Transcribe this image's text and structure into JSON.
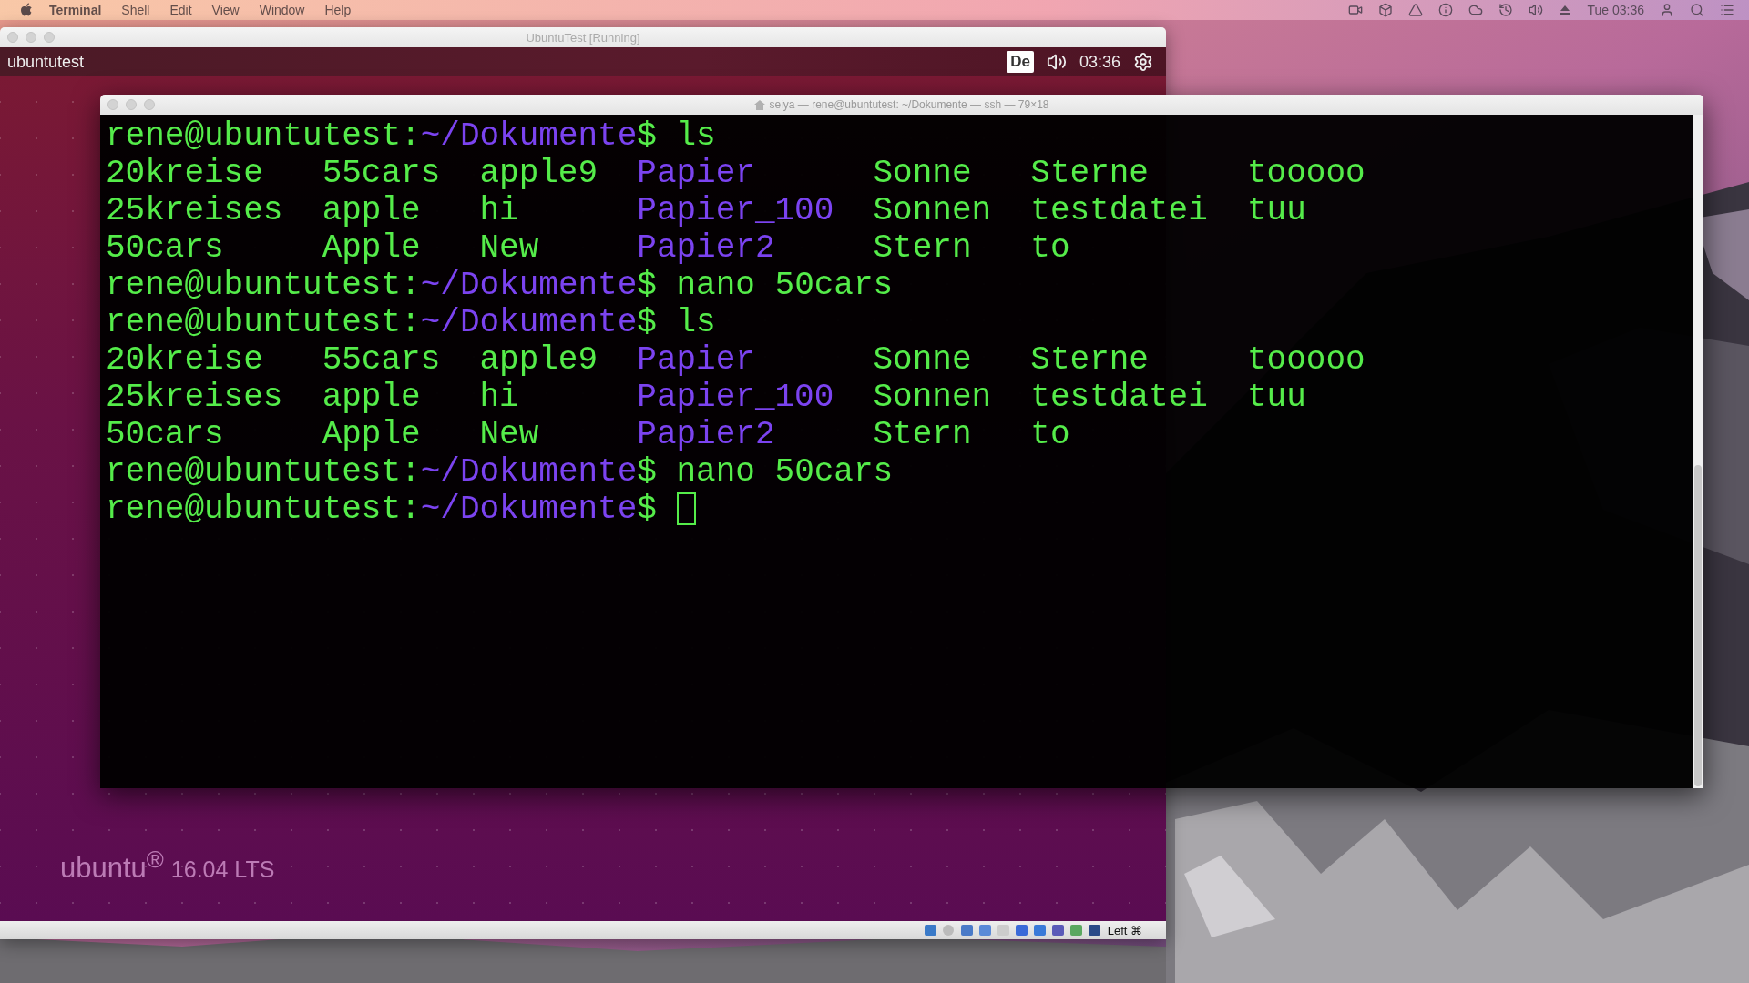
{
  "menubar": {
    "menus": [
      {
        "label": "Terminal",
        "kind": "app"
      },
      {
        "label": "Shell",
        "kind": "menu"
      },
      {
        "label": "Edit",
        "kind": "menu"
      },
      {
        "label": "View",
        "kind": "menu"
      },
      {
        "label": "Window",
        "kind": "menu"
      },
      {
        "label": "Help",
        "kind": "menu"
      }
    ],
    "clock": "Tue 03:36"
  },
  "vm_window": {
    "title": "UbuntuTest [Running]",
    "panel": {
      "hostname": "ubuntutest",
      "keyboard": "De",
      "clock": "03:36"
    },
    "branding": {
      "name": "ubuntu$^{®}$",
      "version": "16.04 LTS"
    },
    "status_bar": {
      "host_key": "Left ⌘"
    }
  },
  "terminal": {
    "title": "seiya — rene@ubuntutest: ~/Dokumente — ssh — 79×18",
    "lines": [
      {
        "kind": "prompt",
        "user": "rene@ubuntutest",
        "separator": ":",
        "path": "~/Dokumente",
        "symbol": "$",
        "command": "ls",
        "cursor": false
      },
      {
        "kind": "listing",
        "rows": [
          [
            {
              "name": "20kreise",
              "kind": "file"
            },
            {
              "name": "55cars",
              "kind": "file"
            },
            {
              "name": "apple9",
              "kind": "file"
            },
            {
              "name": "Papier",
              "kind": "dir"
            },
            {
              "name": "Sonne",
              "kind": "file"
            },
            {
              "name": "Sterne",
              "kind": "file"
            },
            {
              "name": "tooooo",
              "kind": "file"
            }
          ],
          [
            {
              "name": "25kreises",
              "kind": "file"
            },
            {
              "name": "apple",
              "kind": "file"
            },
            {
              "name": "hi",
              "kind": "file"
            },
            {
              "name": "Papier_100",
              "kind": "dir"
            },
            {
              "name": "Sonnen",
              "kind": "file"
            },
            {
              "name": "testdatei",
              "kind": "file"
            },
            {
              "name": "tuu",
              "kind": "file"
            }
          ],
          [
            {
              "name": "50cars",
              "kind": "file"
            },
            {
              "name": "Apple",
              "kind": "file"
            },
            {
              "name": "New",
              "kind": "file"
            },
            {
              "name": "Papier2",
              "kind": "dir"
            },
            {
              "name": "Stern",
              "kind": "file"
            },
            {
              "name": "to",
              "kind": "file"
            }
          ]
        ]
      },
      {
        "kind": "prompt",
        "user": "rene@ubuntutest",
        "separator": ":",
        "path": "~/Dokumente",
        "symbol": "$",
        "command": "nano 50cars",
        "cursor": false
      },
      {
        "kind": "prompt",
        "user": "rene@ubuntutest",
        "separator": ":",
        "path": "~/Dokumente",
        "symbol": "$",
        "command": "ls",
        "cursor": false
      },
      {
        "kind": "listing",
        "rows": [
          [
            {
              "name": "20kreise",
              "kind": "file"
            },
            {
              "name": "55cars",
              "kind": "file"
            },
            {
              "name": "apple9",
              "kind": "file"
            },
            {
              "name": "Papier",
              "kind": "dir"
            },
            {
              "name": "Sonne",
              "kind": "file"
            },
            {
              "name": "Sterne",
              "kind": "file"
            },
            {
              "name": "tooooo",
              "kind": "file"
            }
          ],
          [
            {
              "name": "25kreises",
              "kind": "file"
            },
            {
              "name": "apple",
              "kind": "file"
            },
            {
              "name": "hi",
              "kind": "file"
            },
            {
              "name": "Papier_100",
              "kind": "dir"
            },
            {
              "name": "Sonnen",
              "kind": "file"
            },
            {
              "name": "testdatei",
              "kind": "file"
            },
            {
              "name": "tuu",
              "kind": "file"
            }
          ],
          [
            {
              "name": "50cars",
              "kind": "file"
            },
            {
              "name": "Apple",
              "kind": "file"
            },
            {
              "name": "New",
              "kind": "file"
            },
            {
              "name": "Papier2",
              "kind": "dir"
            },
            {
              "name": "Stern",
              "kind": "file"
            },
            {
              "name": "to",
              "kind": "file"
            }
          ]
        ]
      },
      {
        "kind": "prompt",
        "user": "rene@ubuntutest",
        "separator": ":",
        "path": "~/Dokumente",
        "symbol": "$",
        "command": "nano 50cars",
        "cursor": false
      },
      {
        "kind": "prompt",
        "user": "rene@ubuntutest",
        "separator": ":",
        "path": "~/Dokumente",
        "symbol": "$",
        "cursor": true
      }
    ]
  }
}
